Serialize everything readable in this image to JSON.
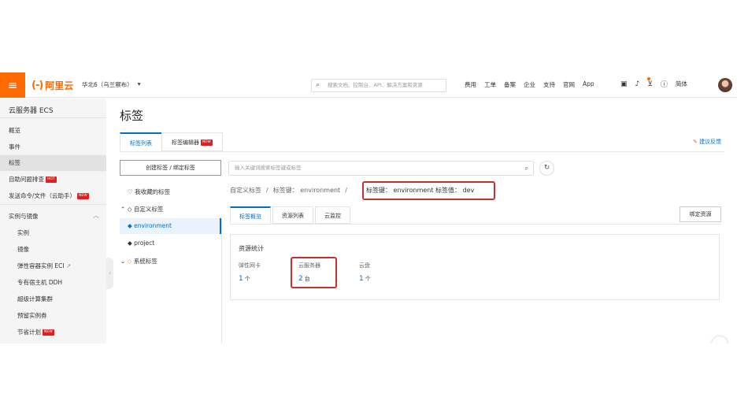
{
  "topbar": {
    "menu_icon": "≡",
    "logo_mark": "(-)",
    "logo_text": "阿里云",
    "region": "华北6（乌兰察布）",
    "region_caret": "▾",
    "search_placeholder": "搜索文档、控制台、API、解决方案和资源",
    "links": [
      "费用",
      "工单",
      "备案",
      "企业",
      "支持",
      "官网",
      "App"
    ],
    "lang": "简体"
  },
  "sidebar": {
    "title": "云服务器 ECS",
    "items": [
      "概览",
      "事件",
      "标签",
      "自助问题排查",
      "发送命令/文件（云助手）"
    ],
    "section": "实例与镜像",
    "sub_items": [
      "实例",
      "镜像",
      "弹性容器实例 ECI",
      "专有宿主机 DDH",
      "超级计算集群",
      "预留实例券",
      "节省计划"
    ],
    "badges": {
      "hot": "HOT",
      "new": "NEW"
    }
  },
  "main": {
    "title": "标签",
    "tabs": [
      "标签列表",
      "标签编辑器"
    ],
    "feedback": "建议反馈",
    "create_button": "创建标签 / 绑定标签",
    "search_placeholder": "输入关键词搜索标签键或标签",
    "tree": {
      "favorites": "我收藏的标签",
      "custom": "自定义标签",
      "custom_items": [
        "environment",
        "project"
      ],
      "system": "系统标签"
    },
    "breadcrumb": {
      "part1": "自定义标签",
      "part2": "标签键：  environment",
      "highlight": "标签键：  environment   标签值：  dev",
      "sep": "/"
    },
    "subtabs": [
      "标签概览",
      "资源列表",
      "云监控"
    ],
    "bind_button": "绑定资源",
    "stats": {
      "title": "资源统计",
      "items": [
        {
          "label": "弹性网卡",
          "value": "1",
          "unit": "个"
        },
        {
          "label": "云服务器",
          "value": "2",
          "unit": "台"
        },
        {
          "label": "云盘",
          "value": "1",
          "unit": "个"
        }
      ]
    }
  }
}
